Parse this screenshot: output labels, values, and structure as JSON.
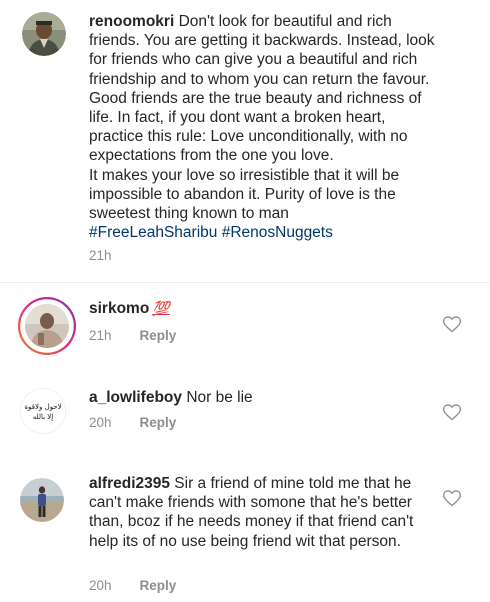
{
  "comments": [
    {
      "username": "renoomokri",
      "text": " Don't look for beautiful and rich friends. You are getting it backwards. Instead, look for friends who can give you a beautiful and rich friendship and to whom you can return the favour. Good friends are the true beauty and richness of life. In fact, if you dont want a broken heart, practice this rule: Love unconditionally, with no expectations from the one you love.\nIt makes your love so irresistible that it will be impossible to abandon it. Purity of love is the sweetest thing known to man",
      "hashtags": "#FreeLeahSharibu #RenosNuggets",
      "time": "21h",
      "reply": ""
    },
    {
      "username": "sirkomo",
      "emoji": "💯",
      "text": "",
      "time": "21h",
      "reply": "Reply"
    },
    {
      "username": "a_lowlifeboy",
      "text": " Nor be lie",
      "time": "20h",
      "reply": "Reply"
    },
    {
      "username": "alfredi2395",
      "text": " Sir a friend of mine told me that he can't make friends with somone that he's better than, bcoz if he needs money if that friend can't help its of no use being friend wit that person.",
      "time": "20h",
      "reply": "Reply"
    }
  ],
  "avatar_text": {
    "a_lowlifeboy": "لاحول ولاقوة إلا بالله"
  },
  "colors": {
    "text": "#262626",
    "meta": "#8e8e8e",
    "hashtag": "#00376b",
    "story_ring_start": "#f58529",
    "story_ring_end": "#dd2a7b"
  },
  "icons": {
    "like": "heart-outline-icon"
  }
}
